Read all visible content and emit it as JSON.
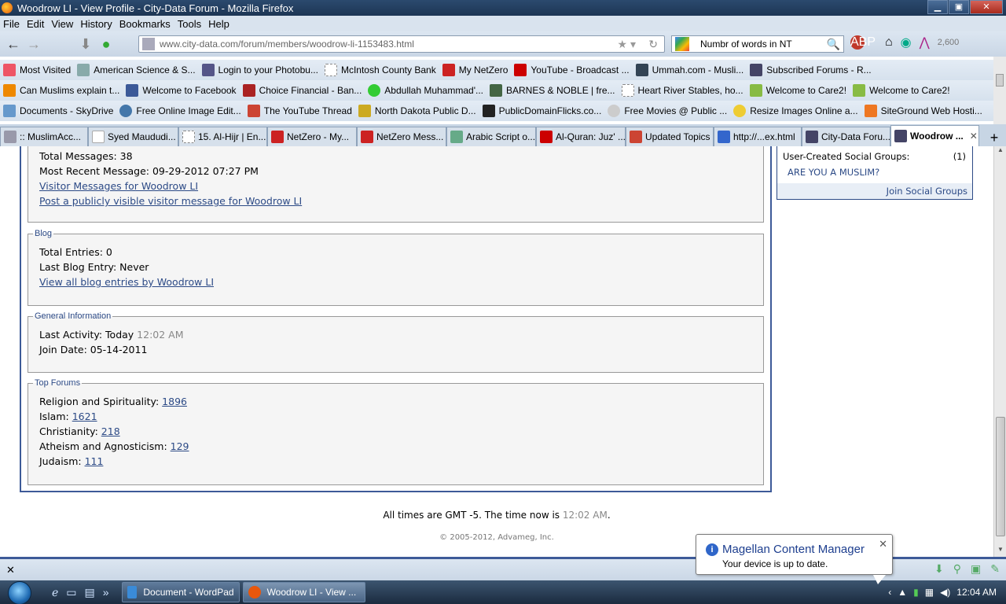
{
  "window": {
    "title": "Woodrow LI - View Profile - City-Data Forum - Mozilla Firefox"
  },
  "menu": [
    "File",
    "Edit",
    "View",
    "History",
    "Bookmarks",
    "Tools",
    "Help"
  ],
  "nav": {
    "url": "www.city-data.com/forum/members/woodrow-li-1153483.html",
    "search_value": "Numbr of words in  NT",
    "counter": "2,600"
  },
  "bookmarks_row1": [
    "Most Visited",
    "American Science & S...",
    "Login to your Photobu...",
    "McIntosh County Bank",
    "My NetZero",
    "YouTube - Broadcast ...",
    "Ummah.com - Musli...",
    "Subscribed Forums - R..."
  ],
  "bookmarks_row2": [
    "Can Muslims explain t...",
    "Welcome to Facebook",
    "Choice Financial - Ban...",
    "Abdullah Muhammad'...",
    "BARNES & NOBLE | fre...",
    "Heart River Stables, ho...",
    "Welcome to Care2!",
    "Welcome to Care2!"
  ],
  "bookmarks_row3": [
    "Documents - SkyDrive",
    "Free Online Image Edit...",
    "The YouTube Thread",
    "North Dakota Public D...",
    "PublicDomainFlicks.co...",
    "Free Movies @ Public ...",
    "Resize Images Online a...",
    "SiteGround Web Hosti..."
  ],
  "tabs": [
    ":: MuslimAcc...",
    "Syed Maududi...",
    "15. Al-Hijr | En...",
    "NetZero - My...",
    "NetZero Mess...",
    "Arabic Script o...",
    "Al-Quran: Juz' ...",
    "Updated Topics",
    "http://...ex.html",
    "City-Data Foru...",
    "Woodrow ..."
  ],
  "messages": {
    "total": "Total Messages: 38",
    "recent": "Most Recent Message: 09-29-2012 07:27 PM",
    "link1": "Visitor Messages for Woodrow LI",
    "link2": "Post a publicly visible visitor message for Woodrow LI"
  },
  "blog": {
    "legend": "Blog",
    "total": "Total Entries: 0",
    "last": "Last Blog Entry: Never",
    "link": "View all blog entries by Woodrow LI"
  },
  "general": {
    "legend": "General Information",
    "activity_label": "Last Activity: Today",
    "activity_time": "12:02 AM",
    "join": "Join Date: 05-14-2011"
  },
  "top_forums": {
    "legend": "Top Forums",
    "items": [
      {
        "name": "Religion and Spirituality:",
        "count": "1896"
      },
      {
        "name": "Islam:",
        "count": "1621"
      },
      {
        "name": "Christianity:",
        "count": "218"
      },
      {
        "name": "Atheism and Agnosticism:",
        "count": "129"
      },
      {
        "name": "Judaism:",
        "count": "111"
      }
    ]
  },
  "social": {
    "header": "User-Created Social Groups:",
    "count": "(1)",
    "group": "ARE YOU A MUSLIM?",
    "join": "Join Social Groups"
  },
  "footer": {
    "times": "All times are GMT -5. The time now is",
    "now": "12:02 AM",
    "copyright": "© 2005-2012, Advameg, Inc."
  },
  "balloon": {
    "title": "Magellan Content Manager",
    "message": "Your device is up to date."
  },
  "taskbar": {
    "tasks": [
      "Document - WordPad",
      "Woodrow LI - View ..."
    ],
    "clock": "12:04 AM"
  }
}
